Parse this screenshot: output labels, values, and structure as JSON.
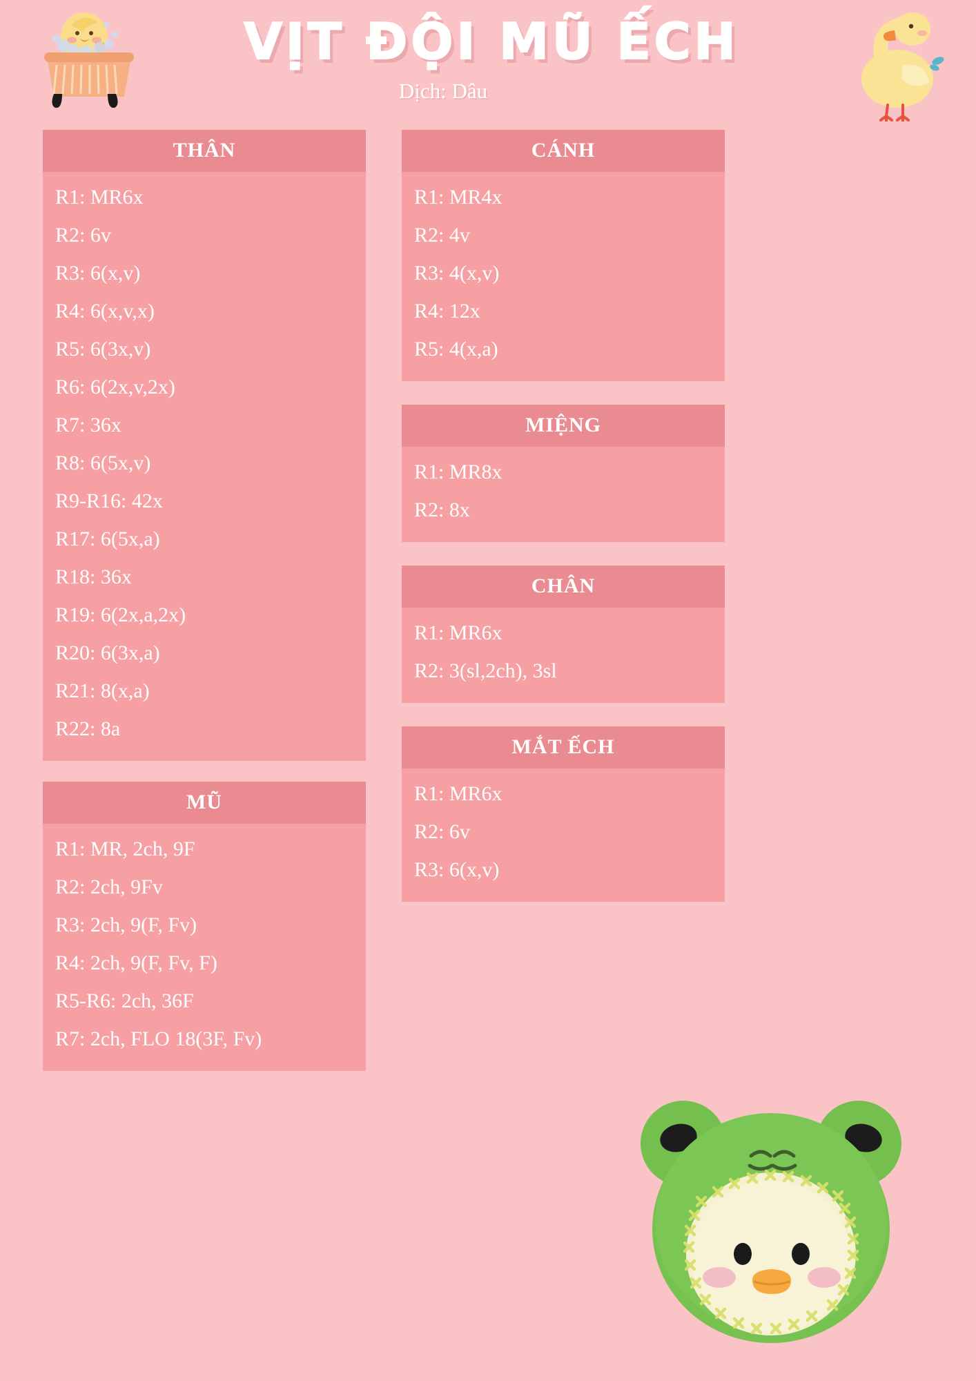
{
  "header": {
    "title": "VỊT ĐỘI MŨ ẾCH",
    "subtitle": "Dịch: Dâu",
    "left_icon": "duck-in-bathtub-illustration",
    "right_icon": "standing-duck-illustration"
  },
  "colors": {
    "page_background": "#fac4c6",
    "card_header": "#e98b90",
    "card_body": "#f6a0a4",
    "text": "#ffffff"
  },
  "left_column": [
    {
      "title": "THÂN",
      "rows": [
        "R1: MR6x",
        "R2: 6v",
        "R3: 6(x,v)",
        "R4: 6(x,v,x)",
        "R5: 6(3x,v)",
        "R6: 6(2x,v,2x)",
        "R7: 36x",
        "R8: 6(5x,v)",
        "R9-R16: 42x",
        "R17: 6(5x,a)",
        "R18: 36x",
        "R19: 6(2x,a,2x)",
        "R20: 6(3x,a)",
        "R21: 8(x,a)",
        "R22: 8a"
      ]
    },
    {
      "title": "MŨ",
      "rows": [
        "R1: MR, 2ch, 9F",
        "R2: 2ch, 9Fv",
        "R3: 2ch, 9(F, Fv)",
        "R4: 2ch, 9(F, Fv, F)",
        "R5-R6: 2ch, 36F",
        "R7: 2ch, FLO 18(3F, Fv)"
      ]
    }
  ],
  "right_column": [
    {
      "title": "CÁNH",
      "rows": [
        "R1: MR4x",
        "R2: 4v",
        "R3: 4(x,v)",
        "R4: 12x",
        "R5: 4(x,a)"
      ]
    },
    {
      "title": "MIỆNG",
      "rows": [
        "R1: MR8x",
        "R2: 8x"
      ]
    },
    {
      "title": "CHÂN",
      "rows": [
        "R1: MR6x",
        "R2: 3(sl,2ch), 3sl"
      ]
    },
    {
      "title": "MẮT ẾCH",
      "rows": [
        "R1: MR6x",
        "R2: 6v",
        "R3: 6(x,v)"
      ]
    }
  ],
  "photo": {
    "caption": "duck-wearing-frog-hat-amigurumi-photo"
  }
}
